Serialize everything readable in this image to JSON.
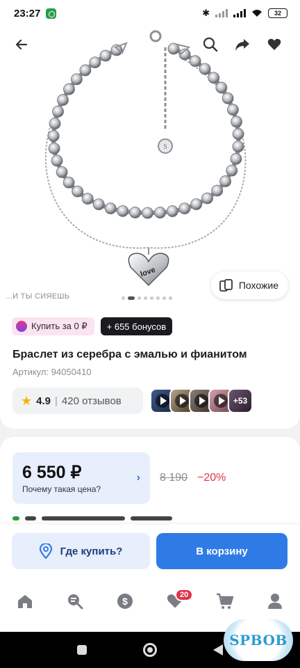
{
  "status_bar": {
    "time": "23:27",
    "battery": "32"
  },
  "hero": {
    "tagline": "...И ТЫ СИЯЕШЬ",
    "similar_label": "Похожие",
    "image_label": "love",
    "image_count": 8,
    "active_image": 1
  },
  "promo": {
    "buy_label": "Купить за 0 ₽",
    "bonus_label": "+ 655 бонусов"
  },
  "product": {
    "title": "Браслет из серебра с эмалью и фианитом",
    "sku": "Артикул: 94050410",
    "rating": "4.9",
    "reviews": "420 отзывов",
    "more_media": "+53"
  },
  "price": {
    "current": "6 550 ₽",
    "why": "Почему такая цена?",
    "old": "8 190",
    "discount": "−20%"
  },
  "actions": {
    "where_label": "Где купить?",
    "cart_label": "В корзину"
  },
  "nav": {
    "favorites_badge": "20"
  },
  "watermark": "SPBOB",
  "colors": {
    "accent": "#2f7be5",
    "discount": "#e0334a",
    "promo_bg": "#fbe3f2"
  }
}
